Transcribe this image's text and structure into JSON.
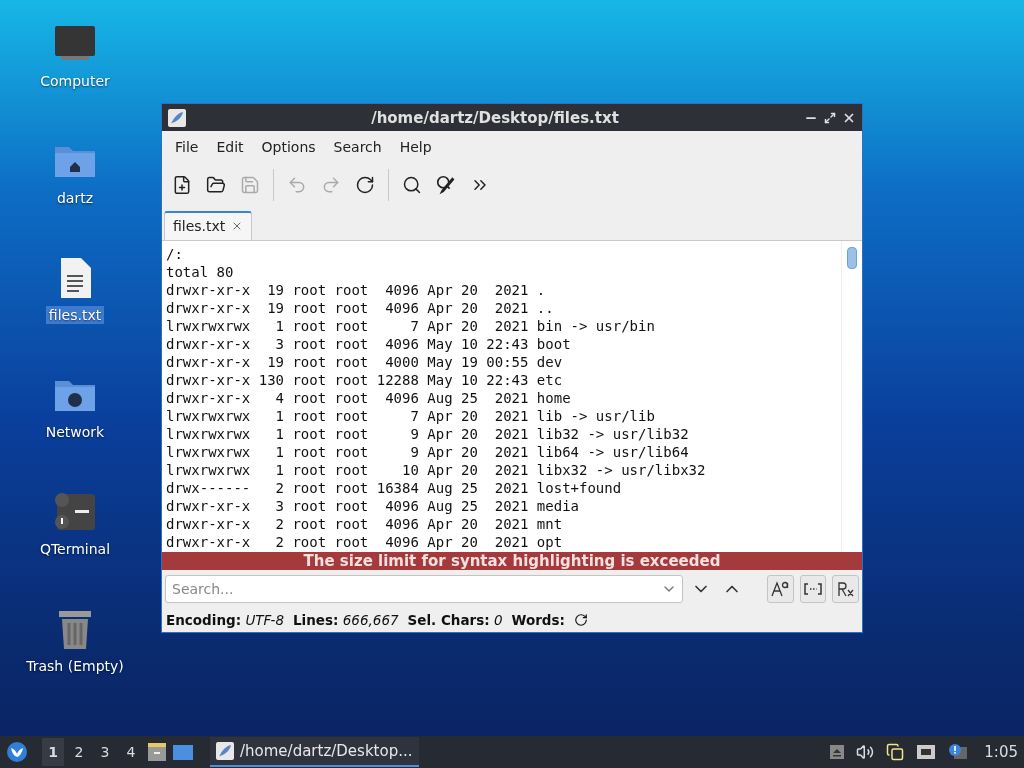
{
  "desktop_icons": [
    {
      "kind": "computer",
      "label": "Computer",
      "selected": false
    },
    {
      "kind": "home",
      "label": "dartz",
      "selected": false
    },
    {
      "kind": "document",
      "label": "files.txt",
      "selected": true
    },
    {
      "kind": "network",
      "label": "Network",
      "selected": false
    },
    {
      "kind": "terminal",
      "label": "QTerminal",
      "selected": false
    },
    {
      "kind": "trash",
      "label": "Trash (Empty)",
      "selected": false
    }
  ],
  "window": {
    "title": "/home/dartz/Desktop/files.txt",
    "menu": [
      "File",
      "Edit",
      "Options",
      "Search",
      "Help"
    ],
    "toolbar": [
      {
        "kind": "new",
        "disabled": false
      },
      {
        "kind": "open",
        "disabled": false
      },
      {
        "kind": "save",
        "disabled": true
      },
      {
        "kind": "separator"
      },
      {
        "kind": "undo",
        "disabled": true
      },
      {
        "kind": "redo",
        "disabled": true
      },
      {
        "kind": "reload",
        "disabled": false
      },
      {
        "kind": "separator"
      },
      {
        "kind": "find",
        "disabled": false
      },
      {
        "kind": "replace",
        "disabled": false
      },
      {
        "kind": "more",
        "disabled": false
      }
    ],
    "tabs": [
      {
        "label": "files.txt",
        "selected": true
      }
    ],
    "lines": [
      "/:",
      "total 80",
      "drwxr-xr-x  19 root root  4096 Apr 20  2021 .",
      "drwxr-xr-x  19 root root  4096 Apr 20  2021 ..",
      "lrwxrwxrwx   1 root root     7 Apr 20  2021 bin -> usr/bin",
      "drwxr-xr-x   3 root root  4096 May 10 22:43 boot",
      "drwxr-xr-x  19 root root  4000 May 19 00:55 dev",
      "drwxr-xr-x 130 root root 12288 May 10 22:43 etc",
      "drwxr-xr-x   4 root root  4096 Aug 25  2021 home",
      "lrwxrwxrwx   1 root root     7 Apr 20  2021 lib -> usr/lib",
      "lrwxrwxrwx   1 root root     9 Apr 20  2021 lib32 -> usr/lib32",
      "lrwxrwxrwx   1 root root     9 Apr 20  2021 lib64 -> usr/lib64",
      "lrwxrwxrwx   1 root root    10 Apr 20  2021 libx32 -> usr/libx32",
      "drwx------   2 root root 16384 Aug 25  2021 lost+found",
      "drwxr-xr-x   3 root root  4096 Aug 25  2021 media",
      "drwxr-xr-x   2 root root  4096 Apr 20  2021 mnt",
      "drwxr-xr-x   2 root root  4096 Apr 20  2021 opt"
    ],
    "banner": "The size limit for syntax highlighting is exceeded",
    "search": {
      "placeholder": "Search..."
    },
    "status_bar": [
      {
        "label": "Encoding:",
        "value": "UTF-8"
      },
      {
        "label": "Lines:",
        "value": "666,667"
      },
      {
        "label": "Sel. Chars:",
        "value": "0"
      },
      {
        "label": "Words:"
      }
    ]
  },
  "taskbar": {
    "workspaces": [
      {
        "label": "1",
        "selected": true
      },
      {
        "label": "2",
        "selected": false
      },
      {
        "label": "3",
        "selected": false
      },
      {
        "label": "4",
        "selected": false
      }
    ],
    "task": "/home/dartz/Desktop...",
    "clock": "1:05"
  }
}
